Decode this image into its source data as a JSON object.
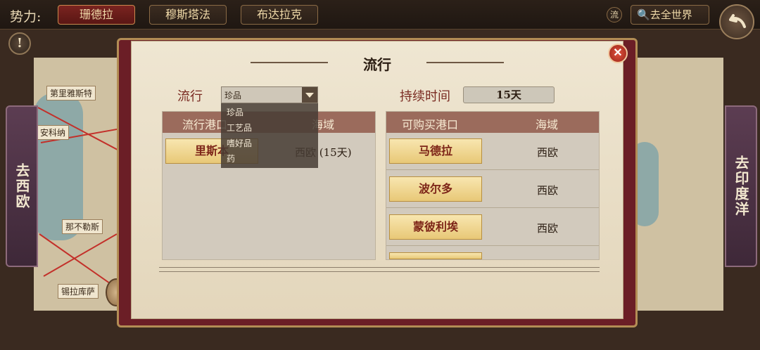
{
  "topbar": {
    "faction_label": "势力:",
    "factions": [
      "珊德拉",
      "穆斯塔法",
      "布达拉克"
    ],
    "liu_label": "流",
    "world_button": "去全世界",
    "alert": "!"
  },
  "map_left": {
    "labels": [
      "第里雅斯特",
      "安科纳",
      "那不勒斯",
      "锡拉库萨"
    ],
    "side_tab": "去西欧"
  },
  "map_right": {
    "side_tab": "去印度洋"
  },
  "dialog": {
    "title": "流行",
    "close": "✕",
    "trend_label": "流行",
    "trend_value": "珍品",
    "duration_label": "持续时间",
    "duration_value": "15天",
    "dropdown_options": [
      "珍品",
      "工艺品",
      "嗜好品",
      "药"
    ],
    "left_panel": {
      "headers": [
        "流行港口",
        "海域"
      ],
      "rows": [
        {
          "port": "里斯本",
          "sea": "西欧 (15天)"
        }
      ]
    },
    "right_panel": {
      "headers": [
        "可购买港口",
        "海域"
      ],
      "rows": [
        {
          "port": "马德拉",
          "sea": "西欧"
        },
        {
          "port": "波尔多",
          "sea": "西欧"
        },
        {
          "port": "蒙彼利埃",
          "sea": "西欧"
        }
      ]
    }
  }
}
